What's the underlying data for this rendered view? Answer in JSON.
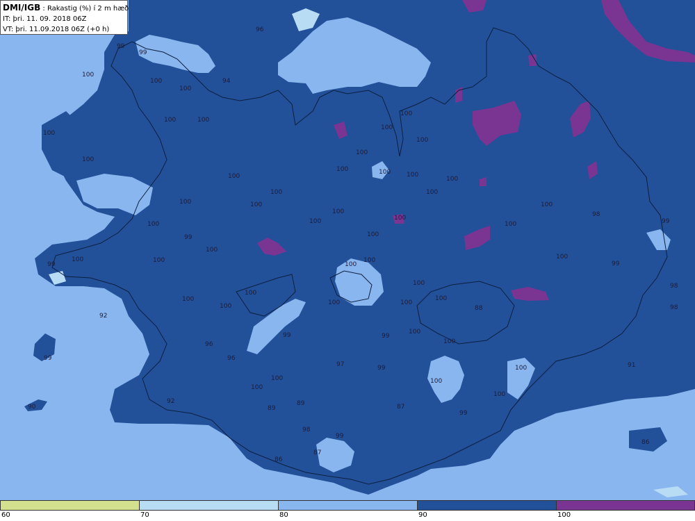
{
  "header": {
    "source": "DMI/IGB",
    "parameter": ": Rakastig (%) í 2 m hæð",
    "it_line": "IT: þri. 11. 09. 2018 06Z",
    "vt_line": "VT: þri. 11.09.2018 06Z (+0 h)"
  },
  "legend": {
    "bins": [
      {
        "label": "60",
        "color": "#d3e08e"
      },
      {
        "label": "70",
        "color": "#b9dcf5"
      },
      {
        "label": "80",
        "color": "#8ab6ef"
      },
      {
        "label": "90",
        "color": "#22519a"
      },
      {
        "label": "100",
        "color": "#7a3592"
      }
    ]
  },
  "colors": {
    "sea": "#8ab6ef",
    "humid_90_100": "#22519a",
    "saturated_100": "#7a3592",
    "light_70_80": "#b9dcf5",
    "coastline": "#0b1f3f"
  },
  "values": [
    "96",
    "99",
    "99",
    "100",
    "100",
    "94",
    "100",
    "100",
    "100",
    "100",
    "100",
    "100",
    "100",
    "100",
    "100",
    "100",
    "100",
    "100",
    "100",
    "100",
    "100",
    "100",
    "100",
    "100",
    "100",
    "100",
    "100",
    "100",
    "100",
    "100",
    "100",
    "98",
    "99",
    "99",
    "100",
    "99",
    "99",
    "98",
    "98",
    "100",
    "100",
    "100",
    "100",
    "100",
    "100",
    "100",
    "100",
    "100",
    "100",
    "100",
    "100",
    "88",
    "92",
    "100",
    "99",
    "99",
    "100",
    "96",
    "99",
    "96",
    "97",
    "100",
    "99",
    "91",
    "100",
    "100",
    "100",
    "100",
    "92",
    "89",
    "90",
    "89",
    "87",
    "99",
    "98",
    "99",
    "86",
    "87",
    "86"
  ]
}
